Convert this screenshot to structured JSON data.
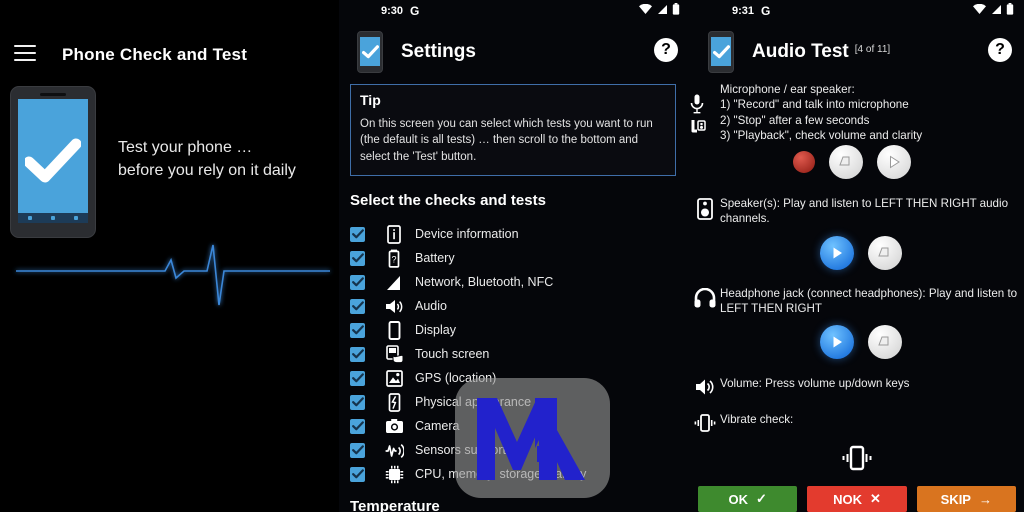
{
  "left_panel": {
    "menu_icon": "hamburger-menu-icon",
    "title": "Phone Check and Test",
    "app_icon": "phone-check-logo",
    "tagline_line1": "Test your phone …",
    "tagline_line2": "before you rely on it daily",
    "graphic": "ecg-heartbeat-line",
    "accent_blue": "#4aa3db",
    "ecg_blue": "#3b87d8"
  },
  "mid_panel": {
    "status_bar": {
      "time": "9:30",
      "assistant_icon": "google-g-icon",
      "wifi_icon": "wifi-icon",
      "signal_icon": "signal-icon",
      "battery_icon": "battery-icon"
    },
    "header": {
      "app_icon": "phone-check-logo",
      "title": "Settings",
      "help_label": "?",
      "help_icon": "help-circle-icon"
    },
    "tip": {
      "heading": "Tip",
      "body": "On this screen you can select which tests you want to run (the default is all tests) … then scroll to the bottom and select the 'Test' button.",
      "border_color": "#3f6ea8"
    },
    "section_title": "Select the checks and tests",
    "checks": [
      {
        "label": "Device information",
        "icon": "info-icon",
        "checked": true
      },
      {
        "label": "Battery",
        "icon": "battery-help-icon",
        "checked": true
      },
      {
        "label": "Network, Bluetooth, NFC",
        "icon": "signal-icon",
        "checked": true
      },
      {
        "label": "Audio",
        "icon": "volume-icon",
        "checked": true
      },
      {
        "label": "Display",
        "icon": "phone-outline-icon",
        "checked": true
      },
      {
        "label": "Touch screen",
        "icon": "touch-icon",
        "checked": true
      },
      {
        "label": "GPS (location)",
        "icon": "gps-icon",
        "checked": true
      },
      {
        "label": "Physical appearance",
        "icon": "phone-crack-icon",
        "checked": true
      },
      {
        "label": "Camera",
        "icon": "camera-icon",
        "checked": true
      },
      {
        "label": "Sensors supported",
        "icon": "sensor-icon",
        "checked": true
      },
      {
        "label": "CPU, memory, storage, battery",
        "icon": "cpu-icon",
        "checked": true
      }
    ],
    "next_section_title": "Temperature",
    "checkbox_color": "#4aa3db"
  },
  "watermark": {
    "text": "MEA",
    "logo_color": "#2222cc"
  },
  "right_panel": {
    "status_bar": {
      "time": "9:31",
      "assistant_icon": "google-g-icon",
      "wifi_icon": "wifi-icon",
      "signal_icon": "signal-icon",
      "battery_icon": "battery-icon"
    },
    "header": {
      "app_icon": "phone-check-logo",
      "title": "Audio Test",
      "step": "[4 of 11]",
      "help_label": "?",
      "help_icon": "help-circle-icon"
    },
    "sections": [
      {
        "icon": "microphone-icon",
        "icon2": "earpiece-call-icon",
        "line1": "Microphone / ear speaker:",
        "line2": "  1) \"Record\" and talk into microphone",
        "line3": "  2) \"Stop\" after a few  seconds",
        "line4": "  3) \"Playback\", check volume and clarity",
        "buttons": [
          "record-button",
          "stop-button",
          "playback-button"
        ]
      },
      {
        "icon": "speaker-icon",
        "text": "Speaker(s): Play and listen to LEFT THEN RIGHT audio channels.",
        "buttons": [
          "play-button",
          "stop-button"
        ]
      },
      {
        "icon": "headphones-icon",
        "text": "Headphone jack (connect headphones): Play and listen to LEFT THEN RIGHT",
        "buttons": [
          "play-button",
          "stop-button"
        ]
      },
      {
        "icon": "volume-icon",
        "text": "Volume: Press volume up/down keys"
      },
      {
        "icon": "vibrate-icon",
        "text": "Vibrate check:"
      }
    ],
    "vibrate_indicator": "vibrate-phone-icon",
    "actions": [
      {
        "label": "OK",
        "glyph": "✓",
        "color": "#3e8a2e",
        "name": "ok-button"
      },
      {
        "label": "NOK",
        "glyph": "✕",
        "color": "#e33b2e",
        "name": "nok-button"
      },
      {
        "label": "SKIP",
        "glyph": "→",
        "color": "#d9741f",
        "name": "skip-button"
      }
    ]
  }
}
